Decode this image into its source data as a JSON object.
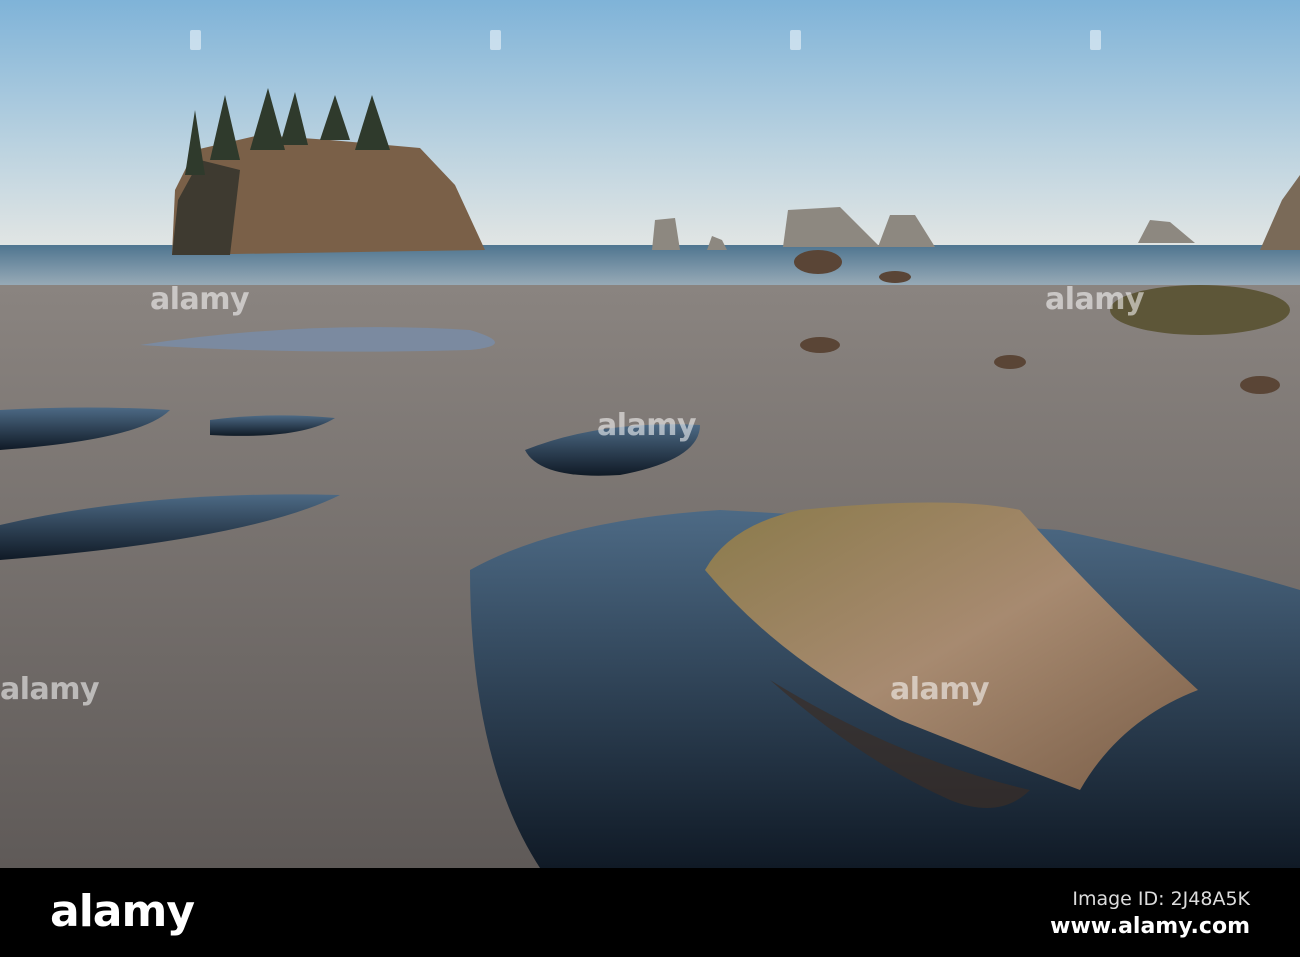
{
  "watermark": {
    "text": "alamy"
  },
  "footer": {
    "logo": "alamy",
    "image_id": "Image ID: 2J48A5K",
    "url": "www.alamy.com"
  },
  "colors": {
    "sky_top": "#7fb3d8",
    "sky_bottom": "#dfe8ec",
    "sand": "#6e6a68",
    "water": "#1e2a3a",
    "rock": "#9a7658"
  }
}
